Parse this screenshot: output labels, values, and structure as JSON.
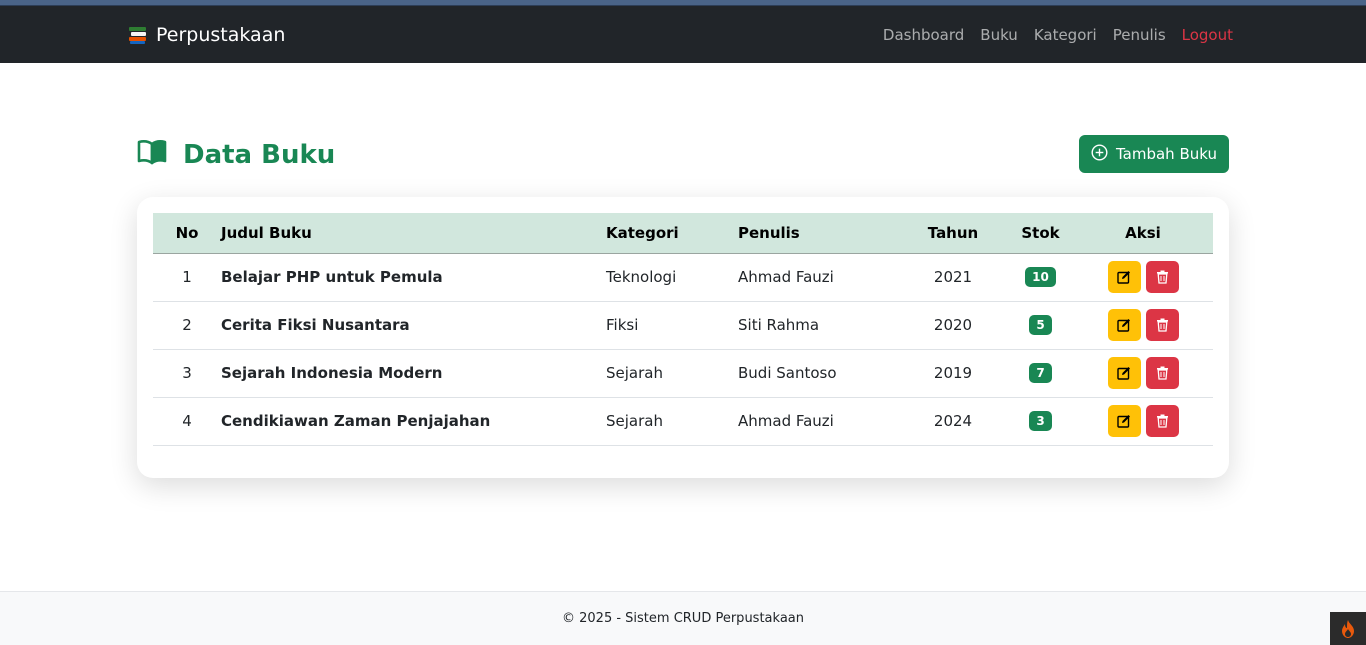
{
  "navbar": {
    "brand": "Perpustakaan",
    "links": [
      {
        "label": "Dashboard"
      },
      {
        "label": "Buku"
      },
      {
        "label": "Kategori"
      },
      {
        "label": "Penulis"
      },
      {
        "label": "Logout"
      }
    ]
  },
  "page": {
    "title": "Data Buku",
    "add_button_label": "Tambah Buku"
  },
  "table": {
    "headers": [
      "No",
      "Judul Buku",
      "Kategori",
      "Penulis",
      "Tahun",
      "Stok",
      "Aksi"
    ],
    "rows": [
      {
        "no": "1",
        "judul": "Belajar PHP untuk Pemula",
        "kategori": "Teknologi",
        "penulis": "Ahmad Fauzi",
        "tahun": "2021",
        "stok": "10"
      },
      {
        "no": "2",
        "judul": "Cerita Fiksi Nusantara",
        "kategori": "Fiksi",
        "penulis": "Siti Rahma",
        "tahun": "2020",
        "stok": "5"
      },
      {
        "no": "3",
        "judul": "Sejarah Indonesia Modern",
        "kategori": "Sejarah",
        "penulis": "Budi Santoso",
        "tahun": "2019",
        "stok": "7"
      },
      {
        "no": "4",
        "judul": "Cendikiawan Zaman Penjajahan",
        "kategori": "Sejarah",
        "penulis": "Ahmad Fauzi",
        "tahun": "2024",
        "stok": "3"
      }
    ]
  },
  "footer": {
    "text": "© 2025 - Sistem CRUD Perpustakaan"
  },
  "colors": {
    "primary": "#198754",
    "danger": "#dc3545",
    "warning": "#ffc107",
    "navbar_bg": "#212529",
    "table_header_bg": "#d1e7dd"
  },
  "icons": {
    "brand": "books-icon",
    "title": "open-book-icon",
    "add": "plus-circle-icon",
    "edit": "pencil-square-icon",
    "delete": "trash-icon",
    "corner": "flame-icon"
  }
}
